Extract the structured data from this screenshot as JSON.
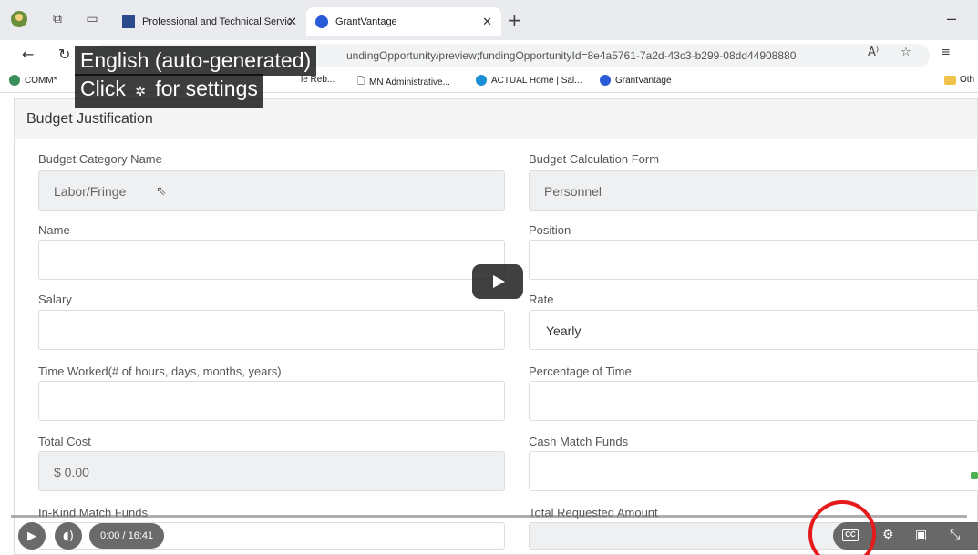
{
  "browser": {
    "tabs": [
      {
        "label": "Professional and Technical Servic"
      },
      {
        "label": "GrantVantage"
      }
    ],
    "url": "undingOpportunity/preview;fundingOpportunityId=8e4a5761-7a2d-43c3-b299-08dd44908880",
    "bookmarks": [
      "COMM*",
      "le Reb...",
      "MN Administrative...",
      "ACTUAL Home | Sal...",
      "GrantVantage",
      "Oth"
    ]
  },
  "captions": {
    "line1": "English (auto-generated)",
    "line2_pre": "Click",
    "line2_post": "for settings"
  },
  "page": {
    "title": "Budget Justification",
    "fields": {
      "budget_category_name": {
        "label": "Budget Category Name",
        "value": "Labor/Fringe"
      },
      "budget_calculation_form": {
        "label": "Budget Calculation Form",
        "value": "Personnel"
      },
      "name": {
        "label": "Name",
        "value": ""
      },
      "position": {
        "label": "Position",
        "value": ""
      },
      "salary": {
        "label": "Salary",
        "value": ""
      },
      "rate": {
        "label": "Rate",
        "value": "Yearly"
      },
      "time_worked": {
        "label": "Time Worked(# of hours, days, months, years)",
        "value": ""
      },
      "percentage_of_time": {
        "label": "Percentage of Time",
        "value": ""
      },
      "total_cost": {
        "label": "Total Cost",
        "value": "$ 0.00"
      },
      "cash_match_funds": {
        "label": "Cash Match Funds",
        "value": ""
      },
      "in_kind_match_funds": {
        "label": "In-Kind Match Funds"
      },
      "total_requested_amount": {
        "label": "Total Requested Amount"
      }
    }
  },
  "player": {
    "time": "0:00 / 16:41",
    "cc_label": "CC",
    "progress": 0
  },
  "colors": {
    "highlight_ring": "#e51b1b",
    "brand_blue": "#2a5bd7"
  }
}
